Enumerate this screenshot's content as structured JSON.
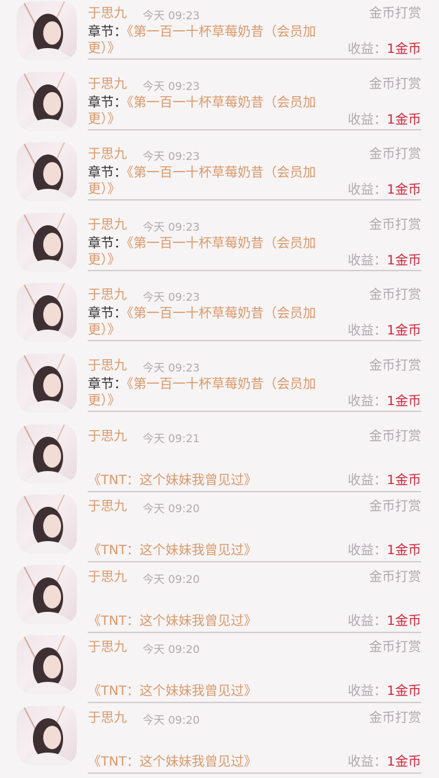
{
  "items": [
    {
      "user": "于思九",
      "time": "今天 09:23",
      "type": "金币打赏",
      "chapter_prefix": "章节：",
      "title": "《第一百一十杯草莓奶昔（会员加更）》",
      "earn_label": "收益：",
      "earn_value": "1金币"
    },
    {
      "user": "于思九",
      "time": "今天 09:23",
      "type": "金币打赏",
      "chapter_prefix": "章节：",
      "title": "《第一百一十杯草莓奶昔（会员加更）》",
      "earn_label": "收益：",
      "earn_value": "1金币"
    },
    {
      "user": "于思九",
      "time": "今天 09:23",
      "type": "金币打赏",
      "chapter_prefix": "章节：",
      "title": "《第一百一十杯草莓奶昔（会员加更）》",
      "earn_label": "收益：",
      "earn_value": "1金币"
    },
    {
      "user": "于思九",
      "time": "今天 09:23",
      "type": "金币打赏",
      "chapter_prefix": "章节：",
      "title": "《第一百一十杯草莓奶昔（会员加更）》",
      "earn_label": "收益：",
      "earn_value": "1金币"
    },
    {
      "user": "于思九",
      "time": "今天 09:23",
      "type": "金币打赏",
      "chapter_prefix": "章节：",
      "title": "《第一百一十杯草莓奶昔（会员加更）》",
      "earn_label": "收益：",
      "earn_value": "1金币"
    },
    {
      "user": "于思九",
      "time": "今天 09:23",
      "type": "金币打赏",
      "chapter_prefix": "章节：",
      "title": "《第一百一十杯草莓奶昔（会员加更）》",
      "earn_label": "收益：",
      "earn_value": "1金币"
    },
    {
      "user": "于思九",
      "time": "今天 09:21",
      "type": "金币打赏",
      "book": "《TNT：这个妹妹我曾见过》",
      "earn_label": "收益：",
      "earn_value": "1金币"
    },
    {
      "user": "于思九",
      "time": "今天 09:20",
      "type": "金币打赏",
      "book": "《TNT：这个妹妹我曾见过》",
      "earn_label": "收益：",
      "earn_value": "1金币"
    },
    {
      "user": "于思九",
      "time": "今天 09:20",
      "type": "金币打赏",
      "book": "《TNT：这个妹妹我曾见过》",
      "earn_label": "收益：",
      "earn_value": "1金币"
    },
    {
      "user": "于思九",
      "time": "今天 09:20",
      "type": "金币打赏",
      "book": "《TNT：这个妹妹我曾见过》",
      "earn_label": "收益：",
      "earn_value": "1金币"
    },
    {
      "user": "于思九",
      "time": "今天 09:20",
      "type": "金币打赏",
      "book": "《TNT：这个妹妹我曾见过》",
      "earn_label": "收益：",
      "earn_value": "1金币"
    }
  ],
  "colors": {
    "accent": "#d99a6c",
    "earn": "#d1283d",
    "muted": "#b0aaae"
  }
}
